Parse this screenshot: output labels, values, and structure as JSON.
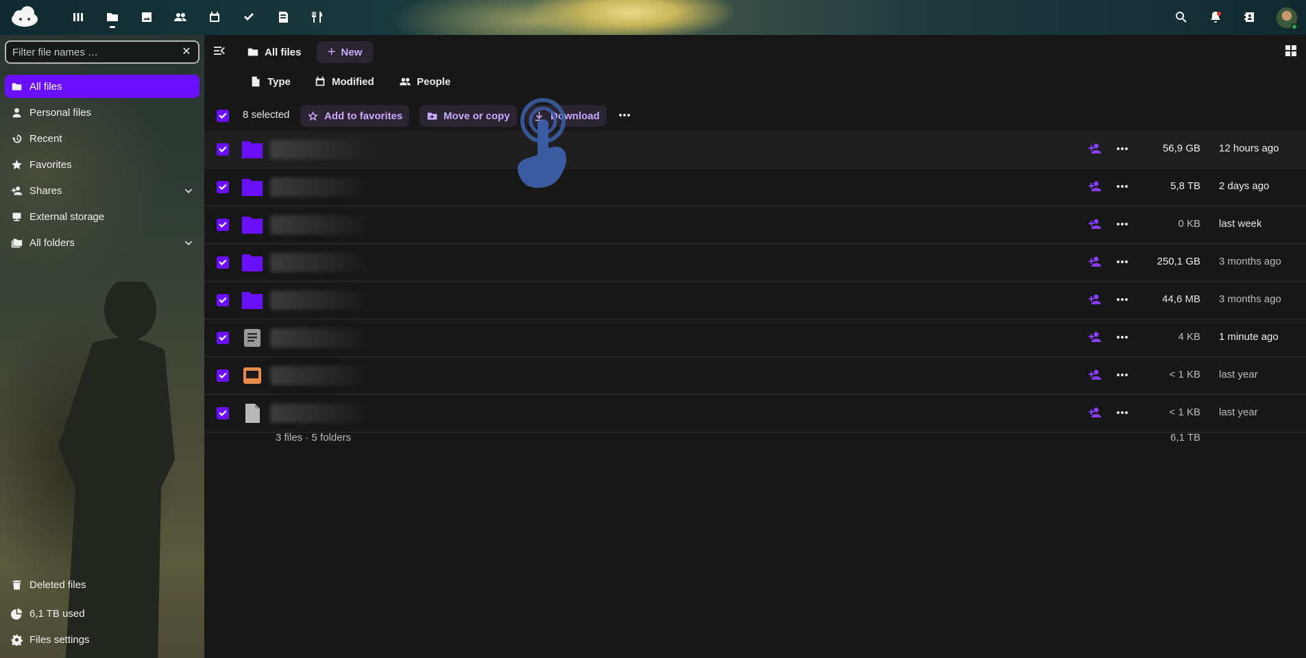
{
  "topbar": {
    "apps": [
      {
        "name": "dashboard-icon"
      },
      {
        "name": "files-icon",
        "active": true
      },
      {
        "name": "photos-icon"
      },
      {
        "name": "contacts-icon"
      },
      {
        "name": "calendar-icon"
      },
      {
        "name": "tasks-icon"
      },
      {
        "name": "notes-icon"
      },
      {
        "name": "cookbook-icon"
      }
    ],
    "right": [
      "search-icon",
      "notifications-icon",
      "contacts-menu-icon",
      "user-avatar"
    ]
  },
  "sidebar": {
    "filter_placeholder": "Filter file names …",
    "items": [
      {
        "label": "All files",
        "icon": "folder-icon",
        "active": true
      },
      {
        "label": "Personal files",
        "icon": "user-icon"
      },
      {
        "label": "Recent",
        "icon": "history-icon"
      },
      {
        "label": "Favorites",
        "icon": "star-icon"
      },
      {
        "label": "Shares",
        "icon": "share-user-icon",
        "expandable": true
      },
      {
        "label": "External storage",
        "icon": "external-storage-icon"
      },
      {
        "label": "All folders",
        "icon": "folders-icon",
        "expandable": true
      }
    ],
    "bottom": [
      {
        "label": "Deleted files",
        "icon": "trash-icon"
      },
      {
        "label": "6,1 TB used",
        "icon": "pie-chart-icon"
      },
      {
        "label": "Files settings",
        "icon": "gear-icon"
      }
    ]
  },
  "main": {
    "breadcrumb": "All files",
    "new_label": "New",
    "filters": [
      "Type",
      "Modified",
      "People"
    ],
    "selection": {
      "count_label": "8 selected",
      "actions": [
        "Add to favorites",
        "Move or copy",
        "Download"
      ]
    },
    "files": [
      {
        "type": "folder",
        "size": "56,9 GB",
        "modified": "12 hours ago"
      },
      {
        "type": "folder",
        "size": "5,8 TB",
        "modified": "2 days ago"
      },
      {
        "type": "folder",
        "size": "0 KB",
        "modified": "last week"
      },
      {
        "type": "folder",
        "size": "250,1 GB",
        "modified": "3 months ago"
      },
      {
        "type": "folder",
        "size": "44,6 MB",
        "modified": "3 months ago"
      },
      {
        "type": "text",
        "size": "4 KB",
        "modified": "1 minute ago"
      },
      {
        "type": "presentation",
        "size": "< 1 KB",
        "modified": "last year"
      },
      {
        "type": "file",
        "size": "< 1 KB",
        "modified": "last year"
      }
    ],
    "summary": {
      "count": "3 files · 5 folders",
      "total": "6,1 TB"
    }
  },
  "colors": {
    "accent": "#6a0fff",
    "folder": "#6a0fff",
    "share": "#8a3dff",
    "action_text": "#c9aaff",
    "presentation": "#e98c4a"
  }
}
